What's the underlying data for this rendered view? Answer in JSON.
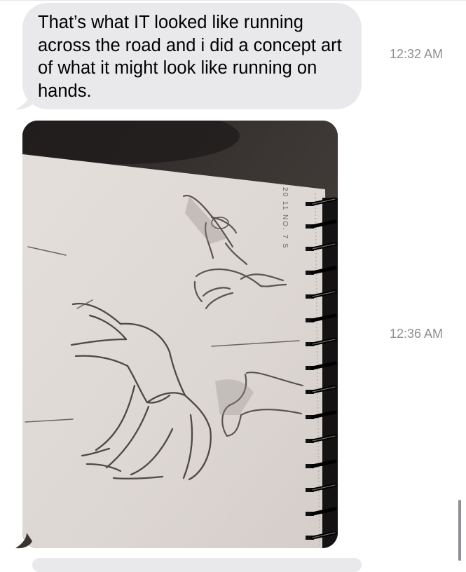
{
  "messages": [
    {
      "type": "text",
      "text": "That’s what IT looked like running across the road and i did a concept art of what it might look like running on hands.",
      "time": "12:32 AM",
      "bubble_color": "#e9e9eb"
    },
    {
      "type": "image",
      "time": "12:36 AM",
      "page_note": "20 11 NO. 7 S"
    }
  ],
  "colors": {
    "background": "#ffffff",
    "received_bubble": "#e9e9eb",
    "timestamp": "#8e8e93"
  },
  "icons": {
    "spiral": "notebook-spiral-icon"
  }
}
